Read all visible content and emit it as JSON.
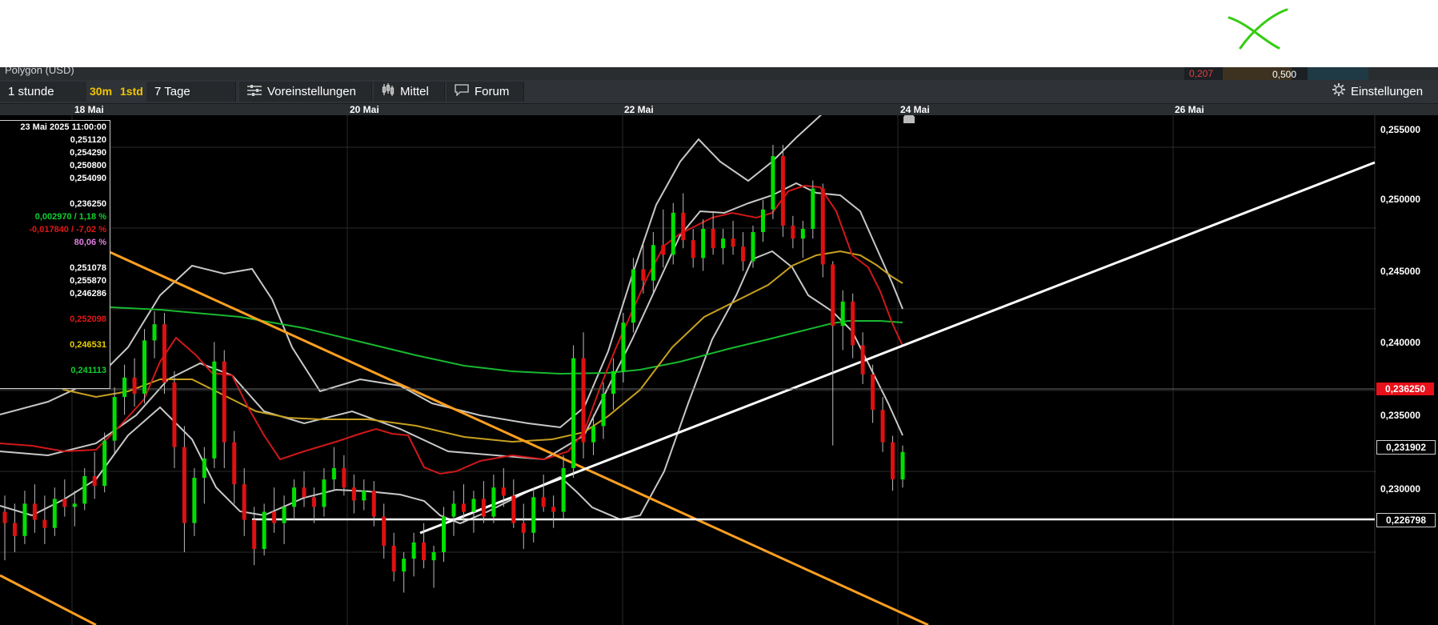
{
  "window": {
    "title": "Polygon (USD)",
    "stat_red": "0,207",
    "stat_value": "0,500"
  },
  "toolbar": {
    "interval": "1 stunde",
    "btn_30m": "30m",
    "btn_1std": "1std",
    "range": "7 Tage",
    "presets": "Voreinstellungen",
    "indicators": "Mittel",
    "forum": "Forum",
    "settings": "Einstellungen"
  },
  "icons": {
    "close": "close-x-icon",
    "presets": "sliders-icon",
    "indicators": "candles-icon",
    "forum": "speech-bubble-icon",
    "settings": "gear-icon",
    "event": "home-marker-icon"
  },
  "colors": {
    "background": "#000000",
    "up": "#00e000",
    "down": "#e01010",
    "orange_trend": "#ffa020",
    "ma_red": "#d01818",
    "ma_yellow": "#c8a020",
    "ma_green": "#18b830",
    "bands": "#c8c8c8",
    "last_price": "#e8101a",
    "close_mark": "#33cc11"
  },
  "info": {
    "datetime": "23 Mai 2025 11:00:00",
    "open": "0,251120",
    "high": "0,254290",
    "low": "0,250800",
    "close": "0,254090",
    "last": "0,236250",
    "change_up": "0,002970 / 1,18 %",
    "change_down": "-0,017840 / -7,02 %",
    "pct": "80,06 %",
    "band_mid": "0,251078",
    "band_up": "0,255870",
    "band_low": "0,246286",
    "ma_red": "0,252098",
    "ma_yellow": "0,246531",
    "ma_green": "0,241113"
  },
  "price_tags": {
    "last": "0,236250",
    "level1": "0,231902",
    "level2": "0,226798"
  },
  "chart_data": {
    "type": "candlestick",
    "x_labels": [
      "18 Mai",
      "20 Mai",
      "22 Mai",
      "24 Mai",
      "26 Mai"
    ],
    "y_labels": [
      "0,255000",
      "0,250000",
      "0,245000",
      "0,240000",
      "0,235000",
      "0,230000"
    ],
    "y_range": [
      0.2265,
      0.2553
    ],
    "grid": true,
    "candles": [
      [
        0.2325,
        0.2335,
        0.2295,
        0.2318
      ],
      [
        0.2318,
        0.233,
        0.23,
        0.231
      ],
      [
        0.231,
        0.2338,
        0.2305,
        0.233
      ],
      [
        0.233,
        0.2342,
        0.2312,
        0.232
      ],
      [
        0.232,
        0.2335,
        0.2305,
        0.2315
      ],
      [
        0.2315,
        0.234,
        0.231,
        0.2333
      ],
      [
        0.2333,
        0.2345,
        0.2322,
        0.2328
      ],
      [
        0.2328,
        0.2338,
        0.2316,
        0.233
      ],
      [
        0.233,
        0.2352,
        0.2326,
        0.2347
      ],
      [
        0.2347,
        0.2362,
        0.2333,
        0.2341
      ],
      [
        0.2341,
        0.2374,
        0.2337,
        0.2369
      ],
      [
        0.2369,
        0.2402,
        0.2361,
        0.2396
      ],
      [
        0.2396,
        0.2416,
        0.2385,
        0.2408
      ],
      [
        0.2408,
        0.242,
        0.239,
        0.2398
      ],
      [
        0.2398,
        0.2438,
        0.2392,
        0.2431
      ],
      [
        0.2431,
        0.2449,
        0.242,
        0.2441
      ],
      [
        0.2441,
        0.2448,
        0.2398,
        0.2405
      ],
      [
        0.2405,
        0.2412,
        0.2352,
        0.2365
      ],
      [
        0.2365,
        0.2378,
        0.23,
        0.2318
      ],
      [
        0.2318,
        0.2352,
        0.231,
        0.2346
      ],
      [
        0.2346,
        0.2365,
        0.233,
        0.2358
      ],
      [
        0.2358,
        0.243,
        0.2352,
        0.2418
      ],
      [
        0.2418,
        0.2425,
        0.2352,
        0.2368
      ],
      [
        0.2368,
        0.2375,
        0.233,
        0.2342
      ],
      [
        0.2342,
        0.2352,
        0.231,
        0.232
      ],
      [
        0.232,
        0.2328,
        0.2292,
        0.2302
      ],
      [
        0.2302,
        0.233,
        0.2298,
        0.2325
      ],
      [
        0.2325,
        0.234,
        0.2312,
        0.2318
      ],
      [
        0.2318,
        0.2335,
        0.2305,
        0.2328
      ],
      [
        0.2328,
        0.2345,
        0.232,
        0.234
      ],
      [
        0.234,
        0.235,
        0.2328,
        0.2334
      ],
      [
        0.2334,
        0.234,
        0.2318,
        0.2328
      ],
      [
        0.2328,
        0.2352,
        0.2322,
        0.2345
      ],
      [
        0.2345,
        0.2365,
        0.2338,
        0.2352
      ],
      [
        0.2352,
        0.236,
        0.2335,
        0.234
      ],
      [
        0.234,
        0.2348,
        0.2324,
        0.2332
      ],
      [
        0.2332,
        0.2345,
        0.2326,
        0.2338
      ],
      [
        0.2338,
        0.2344,
        0.2316,
        0.2322
      ],
      [
        0.2322,
        0.233,
        0.2296,
        0.2304
      ],
      [
        0.2304,
        0.2312,
        0.2282,
        0.2288
      ],
      [
        0.2288,
        0.23,
        0.2275,
        0.2296
      ],
      [
        0.2296,
        0.2312,
        0.2285,
        0.2306
      ],
      [
        0.2306,
        0.2318,
        0.229,
        0.2295
      ],
      [
        0.2295,
        0.2304,
        0.2278,
        0.23
      ],
      [
        0.23,
        0.2328,
        0.2294,
        0.2322
      ],
      [
        0.2322,
        0.2338,
        0.231,
        0.233
      ],
      [
        0.233,
        0.2342,
        0.2318,
        0.2325
      ],
      [
        0.2325,
        0.2338,
        0.2312,
        0.2333
      ],
      [
        0.2333,
        0.2344,
        0.2318,
        0.2322
      ],
      [
        0.2322,
        0.2348,
        0.2318,
        0.234
      ],
      [
        0.234,
        0.2352,
        0.2328,
        0.2335
      ],
      [
        0.2335,
        0.2345,
        0.2315,
        0.2318
      ],
      [
        0.2318,
        0.233,
        0.2302,
        0.2312
      ],
      [
        0.2312,
        0.234,
        0.2306,
        0.2334
      ],
      [
        0.2334,
        0.2348,
        0.2325,
        0.2328
      ],
      [
        0.2328,
        0.2335,
        0.2315,
        0.2325
      ],
      [
        0.2325,
        0.236,
        0.232,
        0.2352
      ],
      [
        0.2352,
        0.2428,
        0.2346,
        0.242
      ],
      [
        0.242,
        0.2436,
        0.2358,
        0.2368
      ],
      [
        0.2368,
        0.2385,
        0.236,
        0.2378
      ],
      [
        0.2378,
        0.2405,
        0.237,
        0.2398
      ],
      [
        0.2398,
        0.242,
        0.2388,
        0.2412
      ],
      [
        0.2412,
        0.2448,
        0.2405,
        0.2442
      ],
      [
        0.2442,
        0.2482,
        0.2436,
        0.2475
      ],
      [
        0.2475,
        0.249,
        0.246,
        0.2468
      ],
      [
        0.2468,
        0.2498,
        0.246,
        0.249
      ],
      [
        0.249,
        0.2512,
        0.2476,
        0.2484
      ],
      [
        0.2484,
        0.2516,
        0.2478,
        0.251
      ],
      [
        0.251,
        0.2522,
        0.2488,
        0.2493
      ],
      [
        0.2493,
        0.25,
        0.2476,
        0.2482
      ],
      [
        0.2482,
        0.2506,
        0.2474,
        0.25
      ],
      [
        0.25,
        0.251,
        0.2484,
        0.2488
      ],
      [
        0.2488,
        0.25,
        0.2478,
        0.2494
      ],
      [
        0.2494,
        0.2505,
        0.2484,
        0.2489
      ],
      [
        0.2489,
        0.2498,
        0.2474,
        0.248
      ],
      [
        0.248,
        0.2502,
        0.2476,
        0.2498
      ],
      [
        0.2498,
        0.2518,
        0.2492,
        0.2512
      ],
      [
        0.2512,
        0.2552,
        0.2506,
        0.2545
      ],
      [
        0.2545,
        0.2552,
        0.2495,
        0.2502
      ],
      [
        0.2502,
        0.2508,
        0.2488,
        0.2494
      ],
      [
        0.2494,
        0.2505,
        0.2482,
        0.25
      ],
      [
        0.25,
        0.253,
        0.2494,
        0.2525
      ],
      [
        0.2525,
        0.2528,
        0.247,
        0.2478
      ],
      [
        0.2478,
        0.248,
        0.2366,
        0.244
      ],
      [
        0.244,
        0.2462,
        0.2425,
        0.2455
      ],
      [
        0.2455,
        0.246,
        0.242,
        0.2428
      ],
      [
        0.2428,
        0.2436,
        0.2404,
        0.241
      ],
      [
        0.241,
        0.2416,
        0.238,
        0.2388
      ],
      [
        0.2388,
        0.2396,
        0.2362,
        0.2368
      ],
      [
        0.2368,
        0.2372,
        0.2338,
        0.2345
      ],
      [
        0.2345,
        0.2366,
        0.234,
        0.2362
      ]
    ]
  }
}
